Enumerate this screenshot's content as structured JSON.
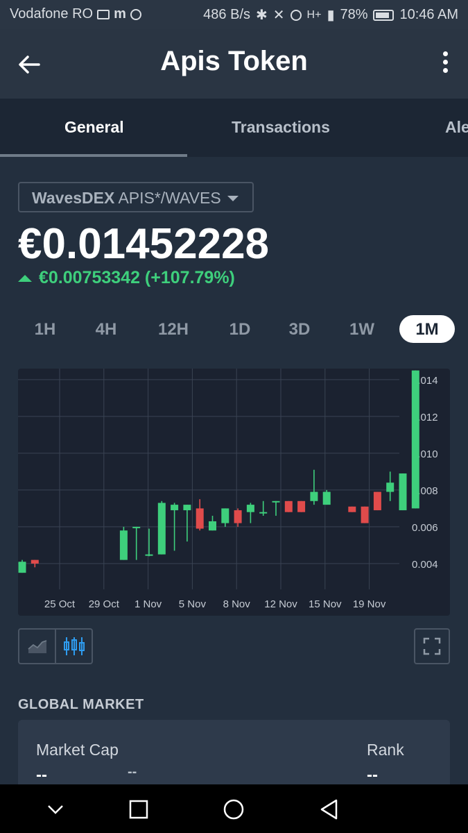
{
  "status_bar": {
    "carrier": "Vodafone RO",
    "m_indicator": "m",
    "net_speed": "486 B/s",
    "signal_label": "H+",
    "battery": "78%",
    "time": "10:46 AM"
  },
  "header": {
    "title": "Apis Token"
  },
  "tabs": [
    {
      "label": "General",
      "active": true
    },
    {
      "label": "Transactions",
      "active": false
    },
    {
      "label": "Alerts",
      "active": false
    }
  ],
  "exchange": {
    "name": "WavesDEX",
    "pair": "APIS*/WAVES"
  },
  "price": {
    "value": "€0.01452228",
    "change": "€0.00753342 (+107.79%)",
    "direction": "up"
  },
  "ranges": [
    {
      "label": "1H",
      "active": false
    },
    {
      "label": "4H",
      "active": false
    },
    {
      "label": "12H",
      "active": false
    },
    {
      "label": "1D",
      "active": false
    },
    {
      "label": "3D",
      "active": false
    },
    {
      "label": "1W",
      "active": false
    },
    {
      "label": "1M",
      "active": true
    }
  ],
  "chart_data": {
    "type": "candlestick",
    "x_labels": [
      "25 Oct",
      "29 Oct",
      "1 Nov",
      "5 Nov",
      "8 Nov",
      "12 Nov",
      "15 Nov",
      "19 Nov"
    ],
    "y_ticks": [
      "0.004",
      "0.006",
      "0.008",
      "0.010",
      "0.012",
      "0.014"
    ],
    "ylim": [
      0.0026,
      0.0146
    ],
    "grid": true,
    "colors": {
      "up": "#3ecf7c",
      "down": "#e04b4b",
      "background": "#1b2230",
      "grid": "#3a4353"
    },
    "candles": [
      {
        "open": 0.0035,
        "close": 0.0041,
        "high": 0.0042,
        "low": 0.0035
      },
      {
        "open": 0.0042,
        "close": 0.004,
        "high": 0.0042,
        "low": 0.0038
      },
      null,
      null,
      null,
      null,
      null,
      null,
      {
        "open": 0.0042,
        "close": 0.0058,
        "high": 0.006,
        "low": 0.0042
      },
      {
        "open": 0.006,
        "close": 0.006,
        "high": 0.006,
        "low": 0.0042
      },
      {
        "open": 0.0045,
        "close": 0.0045,
        "high": 0.0059,
        "low": 0.0044
      },
      {
        "open": 0.0045,
        "close": 0.0073,
        "high": 0.0074,
        "low": 0.0045
      },
      {
        "open": 0.0069,
        "close": 0.0072,
        "high": 0.0073,
        "low": 0.0047
      },
      {
        "open": 0.0069,
        "close": 0.0072,
        "high": 0.0072,
        "low": 0.0052
      },
      {
        "open": 0.007,
        "close": 0.0059,
        "high": 0.0075,
        "low": 0.0058
      },
      {
        "open": 0.0058,
        "close": 0.0063,
        "high": 0.0066,
        "low": 0.0058
      },
      {
        "open": 0.0062,
        "close": 0.007,
        "high": 0.007,
        "low": 0.006
      },
      {
        "open": 0.0069,
        "close": 0.0062,
        "high": 0.007,
        "low": 0.006
      },
      {
        "open": 0.0068,
        "close": 0.0072,
        "high": 0.0073,
        "low": 0.0062
      },
      {
        "open": 0.0068,
        "close": 0.0068,
        "high": 0.0074,
        "low": 0.0066
      },
      {
        "open": 0.0074,
        "close": 0.0074,
        "high": 0.0074,
        "low": 0.0066
      },
      {
        "open": 0.0074,
        "close": 0.0068,
        "high": 0.0074,
        "low": 0.0068
      },
      {
        "open": 0.0074,
        "close": 0.0068,
        "high": 0.0074,
        "low": 0.0068
      },
      {
        "open": 0.0074,
        "close": 0.0079,
        "high": 0.0091,
        "low": 0.0072
      },
      {
        "open": 0.0072,
        "close": 0.0079,
        "high": 0.008,
        "low": 0.0072
      },
      null,
      {
        "open": 0.0071,
        "close": 0.0068,
        "high": 0.0071,
        "low": 0.0068
      },
      {
        "open": 0.0071,
        "close": 0.0062,
        "high": 0.0071,
        "low": 0.0062
      },
      {
        "open": 0.0079,
        "close": 0.0069,
        "high": 0.0079,
        "low": 0.0069
      },
      {
        "open": 0.0079,
        "close": 0.0084,
        "high": 0.009,
        "low": 0.0074
      },
      {
        "open": 0.0069,
        "close": 0.0089,
        "high": 0.0089,
        "low": 0.0069
      },
      {
        "open": 0.007,
        "close": 0.0145,
        "high": 0.0145,
        "low": 0.007
      }
    ]
  },
  "chart_controls": {
    "line_icon": "area-chart-icon",
    "candle_icon": "candlestick-icon",
    "fullscreen_icon": "fullscreen-icon"
  },
  "global_market": {
    "title": "GLOBAL MARKET",
    "market_cap_label": "Market Cap",
    "market_cap_value": "--",
    "middle_value": "--",
    "rank_label": "Rank",
    "rank_value": "--"
  },
  "nav": {
    "icons": [
      "chevron-down-icon",
      "square-icon",
      "circle-icon",
      "triangle-back-icon"
    ]
  }
}
